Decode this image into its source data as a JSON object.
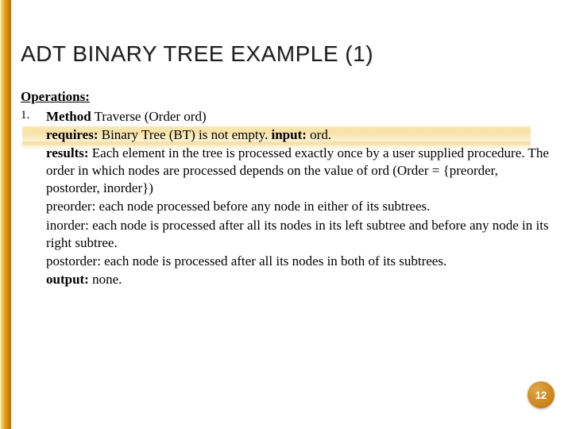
{
  "title": "ADT BINARY TREE  EXAMPLE (1)",
  "section_heading": "Operations:",
  "item_number": "1.",
  "method_label": "Method",
  "method_signature": " Traverse (Order ord)",
  "requires_label": "requires:",
  "requires_text": " Binary Tree (BT) is not empty.  ",
  "input_label": "input:",
  "input_text": " ord.",
  "results_label": "results:",
  "results_text": " Each element in the tree is processed exactly once by a user supplied procedure. The order in which nodes are processed depends on the value of ord (Order = {preorder, postorder, inorder})",
  "preorder_text": "preorder: each node processed before any node in either of its subtrees.",
  "inorder_text": "inorder: each node is processed after all its nodes in its left subtree and before any node in its right subtree.",
  "postorder_text": "postorder: each node is processed after all its nodes in both of its subtrees.",
  "output_label": " output:",
  "output_text": " none.",
  "page_number": "12"
}
